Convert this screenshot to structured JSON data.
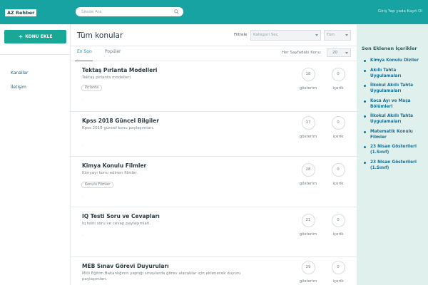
{
  "header": {
    "logo": "AZ Rehber",
    "search_placeholder": "Sitede Ara",
    "login_link": "Giriş Yap yada Kayıt Ol"
  },
  "left": {
    "new_topic_label": "KONU EKLE",
    "nav": [
      "Kanallar",
      "İletişim"
    ]
  },
  "main": {
    "title": "Tüm konular",
    "filter_label": "Filtrele",
    "category_select": "Kategori Seç",
    "scope_select": "Tüm",
    "tabs": [
      "En Son",
      "Popüler"
    ],
    "per_page_label": "Her Sayfadaki Konu:",
    "per_page_value": "20",
    "topics": [
      {
        "title": "Tektaş Pırlanta Modelleri",
        "desc": "Tektaş pırlanta modelleri.",
        "tag": "Pırlanta",
        "views": "18",
        "count": "0",
        "views_label": "gösterim",
        "count_label": "içerik"
      },
      {
        "title": "Kpss 2018 Güncel Bilgiler",
        "desc": "Kpss 2018 güncel konu paylaşımları.",
        "tag": "",
        "views": "17",
        "count": "0",
        "views_label": "gösterim",
        "count_label": "içerik"
      },
      {
        "title": "Kimya Konulu Filmler",
        "desc": "Kimyayı konu edinen filmler.",
        "tag": "Konulu Filmler",
        "views": "28",
        "count": "0",
        "views_label": "gösterim",
        "count_label": "içerik"
      },
      {
        "title": "IQ Testi Soru ve Cevapları",
        "desc": "Iq testi soru ve cevap paylaşımları.",
        "tag": "",
        "views": "21",
        "count": "0",
        "views_label": "gösterim",
        "count_label": "içerik"
      },
      {
        "title": "MEB Sınav Görevi Duyuruları",
        "desc": "Milli Eğitim Bakanlığının yaptığı sınavlarda görev alacaklar için eklenecek duyuru paylaşımları.",
        "tag": "",
        "views": "29",
        "count": "0",
        "views_label": "gösterim",
        "count_label": "içerik"
      }
    ]
  },
  "right": {
    "title": "Son Eklenen İçerikler",
    "items": [
      "Kimya Konulu Diziler",
      "Akıllı Tahta Uygulamaları",
      "İlkokul Akıllı Tahta Uygulamaları",
      "Koca Ayı ve Maşa Bölümleri",
      "İlkokul Akıllı Tahta Uygulamaları",
      "Matematik Konulu Filmler",
      "23 Nisan Gösterileri (1.Sınıf)",
      "23 Nisan Gösterileri (1.Sınıf)"
    ]
  },
  "colors": {
    "header": "#17a3a2",
    "button": "#1aa896",
    "link": "#1b6f93",
    "right_panel": "#dff0ed"
  }
}
